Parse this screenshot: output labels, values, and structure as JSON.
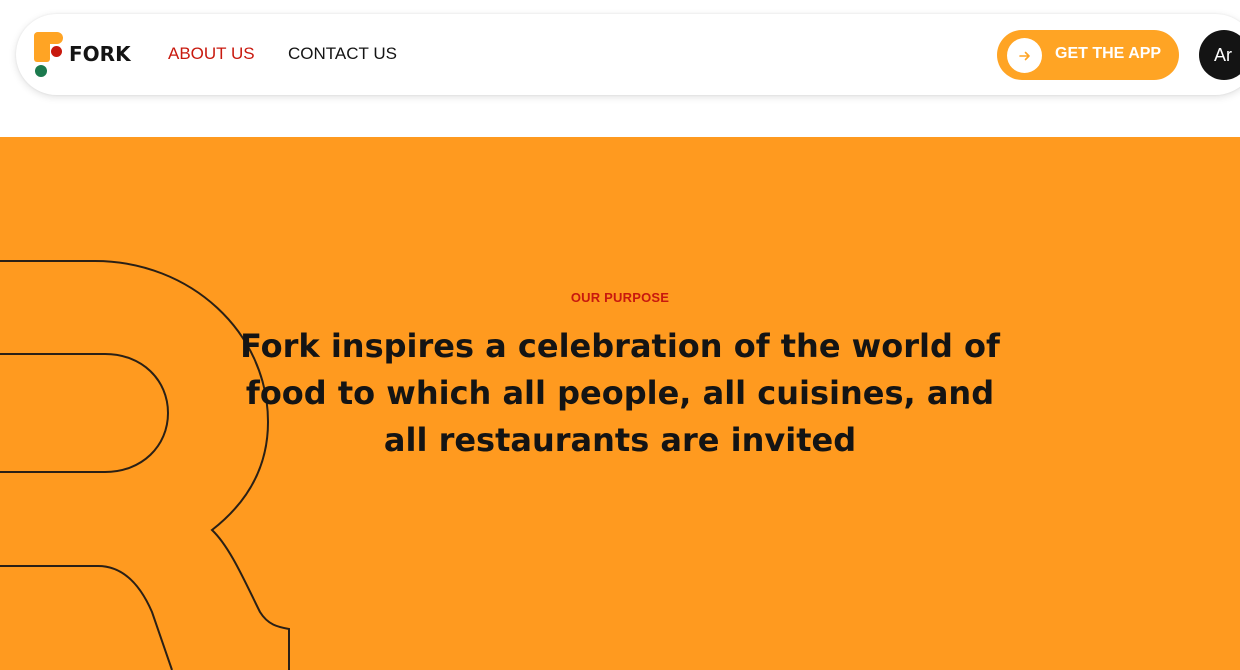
{
  "brand": {
    "name": "FORK",
    "colors": {
      "orange": "#ff9a1f",
      "red": "#c8190e",
      "green": "#1c7a4e",
      "dark": "#141414"
    }
  },
  "nav": {
    "items": [
      {
        "label": "ABOUT US",
        "active": true
      },
      {
        "label": "CONTACT US",
        "active": false
      }
    ]
  },
  "cta": {
    "label": "GET THE APP",
    "icon": "arrow-right-icon"
  },
  "language": {
    "label": "Ar"
  },
  "hero": {
    "eyebrow": "OUR PURPOSE",
    "headline": "Fork inspires a celebration of the world of food to which all people, all cuisines, and all restaurants are invited",
    "decoration": "outlined-letter-R"
  }
}
